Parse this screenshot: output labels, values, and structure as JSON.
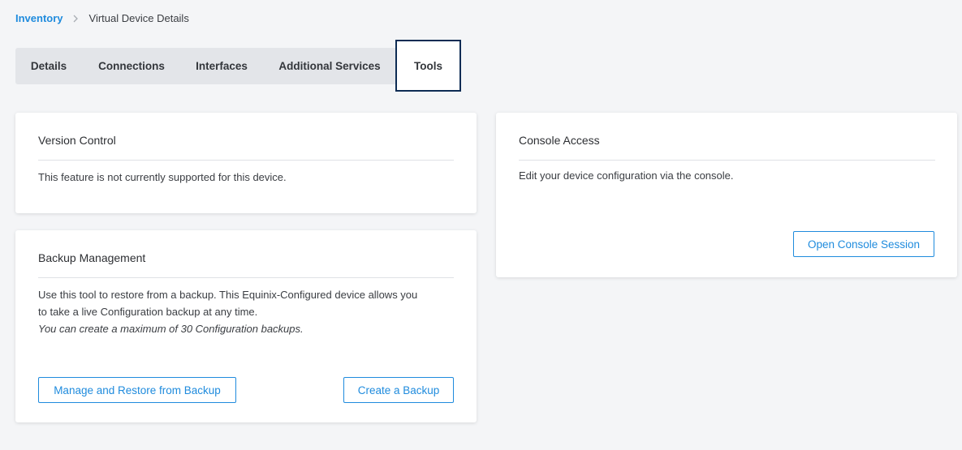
{
  "breadcrumb": {
    "root": "Inventory",
    "separator_icon": "chevron-right-icon",
    "current": "Virtual Device Details"
  },
  "tabs": [
    {
      "label": "Details",
      "active": false
    },
    {
      "label": "Connections",
      "active": false
    },
    {
      "label": "Interfaces",
      "active": false
    },
    {
      "label": "Additional Services",
      "active": false
    },
    {
      "label": "Tools",
      "active": true
    }
  ],
  "version_control": {
    "title": "Version Control",
    "message": "This feature is not currently supported for this device."
  },
  "backup_management": {
    "title": "Backup Management",
    "description_line1": "Use this tool to restore from a backup. This Equinix-Configured device allows you",
    "description_line2": "to take a live Configuration backup at any time.",
    "note": "You can create a maximum of 30 Configuration backups.",
    "manage_button": "Manage and Restore from Backup",
    "create_button": "Create a Backup"
  },
  "console_access": {
    "title": "Console Access",
    "description": "Edit your device configuration via the console.",
    "open_button": "Open Console Session"
  },
  "colors": {
    "accent": "#1f8bdd",
    "active_tab_border": "#0d2c54",
    "background": "#f4f5f7",
    "tab_bar": "#e3e5e9"
  }
}
